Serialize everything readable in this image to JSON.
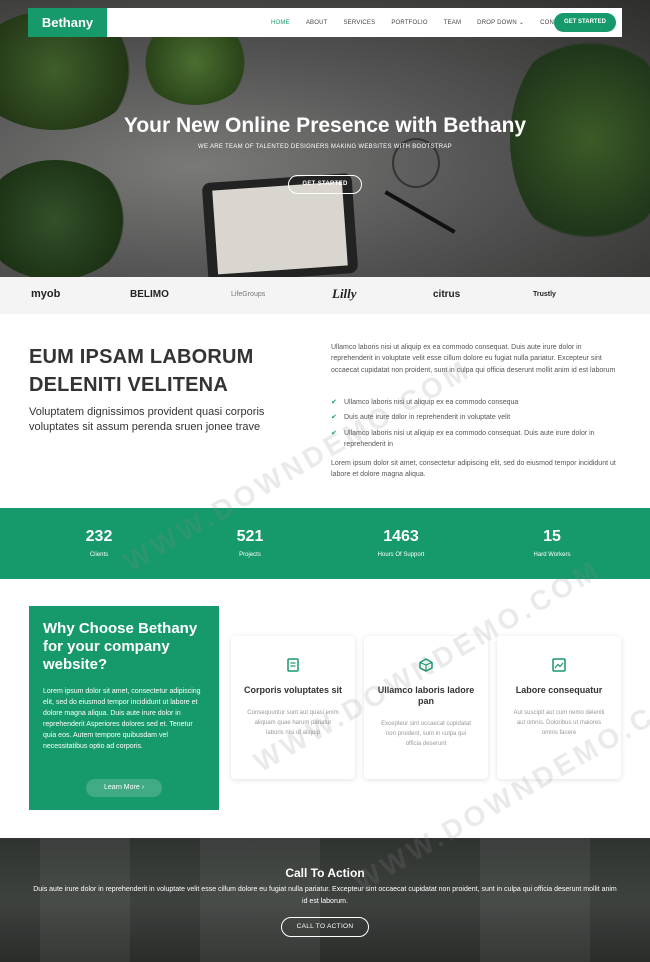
{
  "brand": {
    "name": "Bethany",
    "accent": "#16996b"
  },
  "nav": {
    "items": [
      {
        "label": "HOME",
        "active": true
      },
      {
        "label": "ABOUT"
      },
      {
        "label": "SERVICES"
      },
      {
        "label": "PORTFOLIO"
      },
      {
        "label": "TEAM"
      },
      {
        "label": "DROP DOWN"
      },
      {
        "label": "CONTACT"
      }
    ],
    "cta": "GET STARTED"
  },
  "hero": {
    "title": "Your New Online Presence with Bethany",
    "subtitle": "WE ARE TEAM OF TALENTED DESIGNERS MAKING WEBSITES WITH BOOTSTRAP",
    "button": "GET STARTED"
  },
  "clients": [
    "myob",
    "BELIMO",
    "LifeGroups",
    "Lilly",
    "citrus",
    "Trustly"
  ],
  "about": {
    "title": "EUM IPSAM LABORUM DELENITI VELITENA",
    "lead": "Voluptatem dignissimos provident quasi corporis voluptates sit assum perenda sruen jonee trave",
    "p1": "Ullamco laboris nisi ut aliquip ex ea commodo consequat. Duis aute irure dolor in reprehenderit in voluptate velit esse cillum dolore eu fugiat nulla pariatur. Excepteur sint occaecat cupidatat non proident, sunt in culpa qui officia deserunt mollit anim id est laborum",
    "list": [
      "Ullamco laboris nisi ut aliquip ex ea commodo consequa",
      "Duis aute irure dolor in reprehenderit in voluptate velit",
      "Ullamco laboris nisi ut aliquip ex ea commodo consequat. Duis aute irure dolor in reprehenderit in"
    ],
    "p2": "Lorem ipsum dolor sit amet, consectetur adipiscing elit, sed do eiusmod tempor incididunt ut labore et dolore magna aliqua."
  },
  "counts": [
    {
      "value": "232",
      "label": "Clients"
    },
    {
      "value": "521",
      "label": "Projects"
    },
    {
      "value": "1463",
      "label": "Hours Of Support"
    },
    {
      "value": "15",
      "label": "Hard Workers"
    }
  ],
  "why": {
    "title": "Why Choose Bethany for your company website?",
    "text": "Lorem ipsum dolor sit amet, consectetur adipiscing elit, sed do eiusmod tempor incididunt ut labore et dolore magna aliqua. Duis aute irure dolor in reprehenderit Asperiores dolores sed et. Tenetur quia eos. Autem tempore quibusdam vel necessitatibus optio ad corporis.",
    "button": "Learn More"
  },
  "boxes": [
    {
      "icon": "receipt-icon",
      "title": "Corporis voluptates sit",
      "text": "Consequuntur sunt aut quasi enim aliquam quae harum pariatur laboris nisi ut aliquip"
    },
    {
      "icon": "cube-icon",
      "title": "Ullamco laboris ladore pan",
      "text": "Excepteur sint occaecat cupidatat non proident, sunt in culpa qui officia deserunt"
    },
    {
      "icon": "image-icon",
      "title": "Labore consequatur",
      "text": "Aut suscipit aut cum nemo deleniti aut omnis. Doloribus ut maiores omnis facere"
    }
  ],
  "cta": {
    "title": "Call To Action",
    "text": "Duis aute irure dolor in reprehenderit in voluptate velit esse cillum dolore eu fugiat nulla pariatur. Excepteur sint occaecat cupidatat non proident, sunt in culpa qui officia deserunt mollit anim id est laborum.",
    "button": "CALL TO ACTION"
  },
  "watermark": "WWW.DOWNDEMO.COM"
}
